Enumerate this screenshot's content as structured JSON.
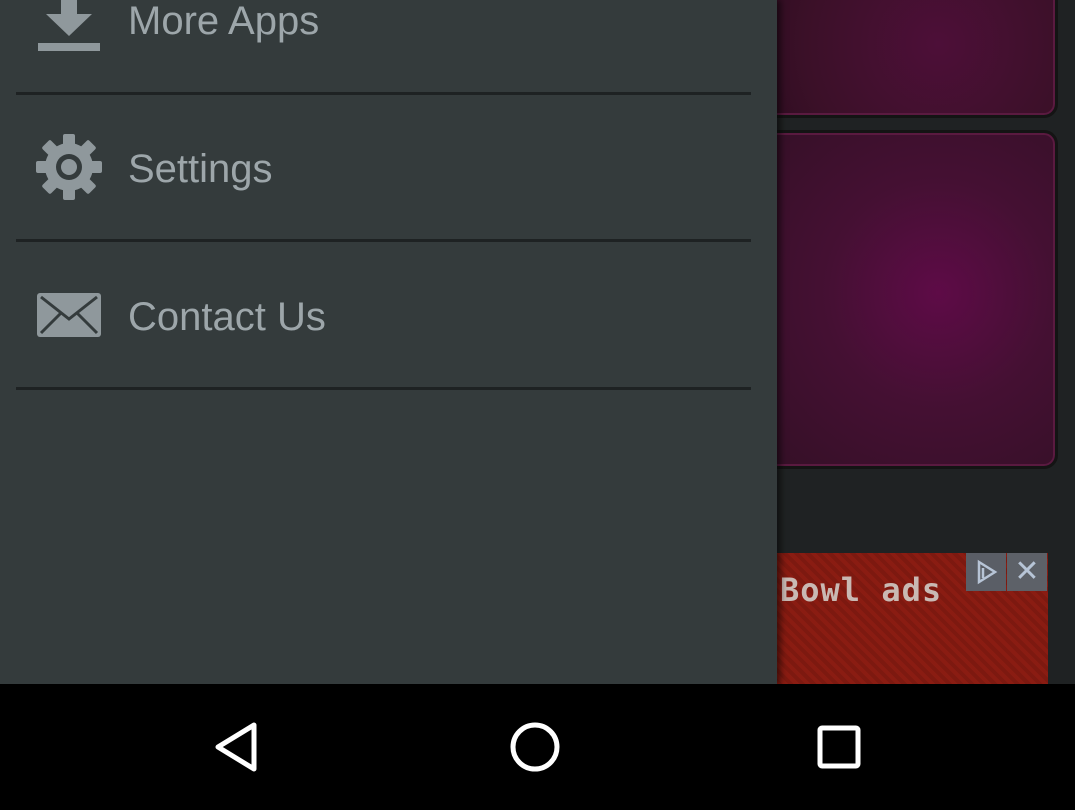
{
  "drawer": {
    "items": [
      {
        "label": "More Apps",
        "icon": "download-icon"
      },
      {
        "label": "Settings",
        "icon": "gear-icon"
      },
      {
        "label": "Contact Us",
        "icon": "envelope-icon"
      }
    ]
  },
  "background": {
    "ad_text": "Bowl ads",
    "ad_info_icon": "adchoices-icon",
    "ad_close_icon": "close-icon",
    "ad_close_glyph": "✕"
  },
  "navbar": {
    "back_icon": "back-icon",
    "home_icon": "home-icon",
    "recents_icon": "recents-icon"
  },
  "colors": {
    "drawer_bg": "#343b3c",
    "label": "#9da6aa",
    "tile_accent": "#5e0b47",
    "ad_bg": "#8a1c12"
  }
}
